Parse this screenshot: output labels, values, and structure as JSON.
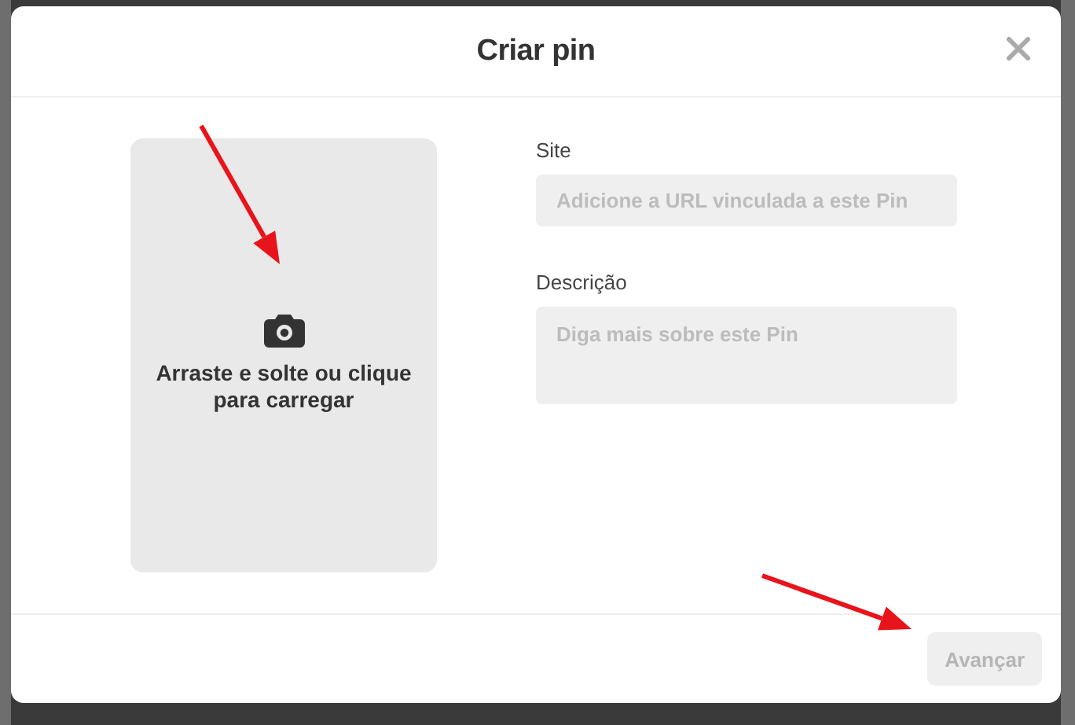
{
  "dialog": {
    "title": "Criar pin"
  },
  "upload": {
    "label": "Arraste e solte ou clique para carregar"
  },
  "fields": [
    {
      "kind": "line",
      "label": "Site",
      "placeholder": "Adicione a URL vinculada a este Pin"
    },
    {
      "kind": "area",
      "label": "Descrição",
      "placeholder": "Diga mais sobre este Pin"
    }
  ],
  "footer": {
    "button": {
      "label": "Avançar",
      "disabled": true
    }
  }
}
